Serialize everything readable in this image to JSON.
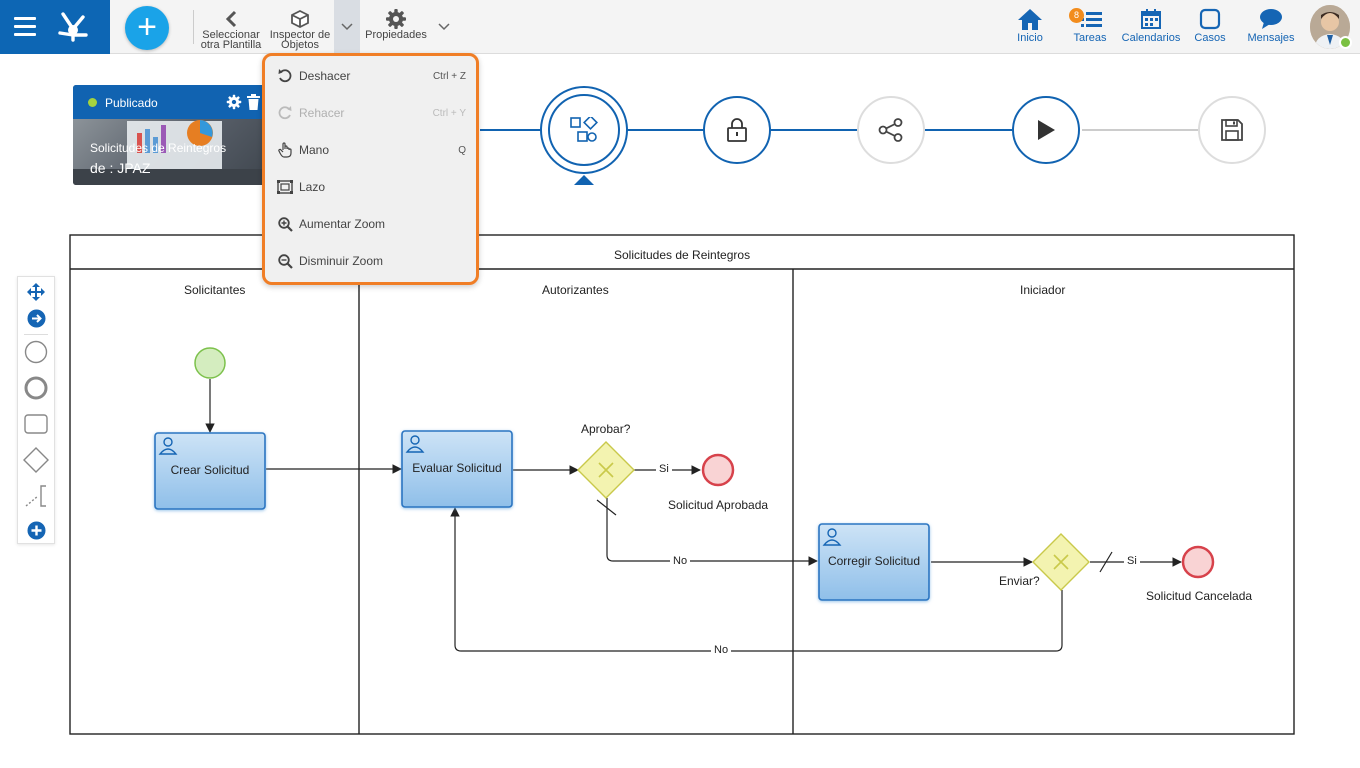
{
  "topbar": {
    "tools": [
      {
        "label_1": "Seleccionar",
        "label_2": "otra Plantilla",
        "icon": "chevron-left-icon"
      },
      {
        "label_1": "Inspector de",
        "label_2": "Objetos",
        "icon": "cube-icon"
      },
      {
        "label_1": "Propiedades",
        "label_2": "",
        "icon": "gear-icon"
      }
    ],
    "nav": [
      {
        "label": "Inicio",
        "icon": "home-icon"
      },
      {
        "label": "Tareas",
        "icon": "tasks-icon",
        "badge": "8"
      },
      {
        "label": "Calendarios",
        "icon": "calendar-icon"
      },
      {
        "label": "Casos",
        "icon": "case-icon"
      },
      {
        "label": "Mensajes",
        "icon": "chat-icon"
      }
    ]
  },
  "process_card": {
    "status": "Publicado",
    "title": "Solicitudes de Reintegros",
    "subtitle": "de : JPAZ"
  },
  "edit_menu": {
    "items": [
      {
        "label": "Deshacer",
        "shortcut": "Ctrl + Z",
        "icon": "undo-icon",
        "enabled": true
      },
      {
        "label": "Rehacer",
        "shortcut": "Ctrl + Y",
        "icon": "redo-icon",
        "enabled": false
      },
      {
        "label": "Mano",
        "shortcut": "Q",
        "icon": "hand-icon",
        "enabled": true
      },
      {
        "label": "Lazo",
        "shortcut": "",
        "icon": "lasso-icon",
        "enabled": true
      },
      {
        "label": "Aumentar Zoom",
        "shortcut": "",
        "icon": "zoom-in-icon",
        "enabled": true
      },
      {
        "label": "Disminuir Zoom",
        "shortcut": "",
        "icon": "zoom-out-icon",
        "enabled": true
      }
    ]
  },
  "steps": [
    "shapes-icon",
    "lock-icon",
    "share-icon",
    "play-icon",
    "save-icon"
  ],
  "diagram": {
    "pool": "Solicitudes de Reintegros",
    "lanes": [
      "Solicitantes",
      "Autorizantes",
      "Iniciador"
    ],
    "tasks": [
      "Crear Solicitud",
      "Evaluar Solicitud",
      "Corregir Solicitud"
    ],
    "gateways": [
      "Aprobar?",
      "Enviar?"
    ],
    "end_events": [
      "Solicitud Aprobada",
      "Solicitud Cancelada"
    ],
    "flow_labels": {
      "yes": "Si",
      "no": "No"
    }
  },
  "colors": {
    "brand": "#0d66b4",
    "accent": "#1aa3e8",
    "menu_border": "#f07e26",
    "task_fill": "#a9cdee",
    "gateway_fill": "#f3f3b0",
    "end_stroke": "#d7424b"
  }
}
